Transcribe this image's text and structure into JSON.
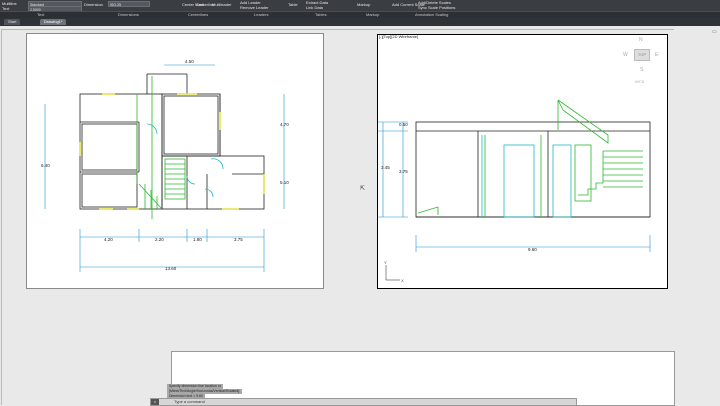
{
  "ribbon": {
    "left_top": "Multiline",
    "left_bottom": "Text",
    "dimension_label": "Dimension",
    "center_mark": "Center Mark",
    "centerline": "Centerline",
    "multileader": "Multileader",
    "add_leader": "Add Leader",
    "remove_leader": "Remove Leader",
    "table": "Table",
    "extract_data": "Extract Data",
    "link_data": "Link Data",
    "markup_import": "Markup",
    "add_current_scale": "Add Current Scale",
    "add_delete_scales": "Add/Delete Scales",
    "sync_scale": "Sync Scale Positions",
    "font_value": "Standard",
    "size_value": "2.5000",
    "dim_style": "ISO-25"
  },
  "panels": [
    "Text",
    "Dimensions",
    "Centerlines",
    "Leaders",
    "Tables",
    "Markup",
    "Annotation Scaling"
  ],
  "tabs": [
    {
      "label": "Start"
    },
    {
      "label": "Drawing1*"
    }
  ],
  "viewport": {
    "label": "[-][Top][2D Wireframe]"
  },
  "viewcube": {
    "n": "N",
    "w": "W",
    "top": "TOP",
    "e": "E",
    "s": "S",
    "wcs": "WCS"
  },
  "plan": {
    "dims": {
      "top_width": "4.50",
      "right_upper": "4.70",
      "right_lower": "5.10",
      "left_height": "6.40",
      "bottom_a": "4.20",
      "bottom_b": "2.20",
      "bottom_c": "1.80",
      "bottom_d": "3.75",
      "bottom_total": "13.60"
    }
  },
  "section": {
    "dims": {
      "upper": "0.50",
      "mid": "3.45",
      "left": "3.75",
      "width": "9.60"
    }
  },
  "command": {
    "history": [
      "Specify dimension line location or",
      "[Mtext/Text/Angle/Horizontal/Vertical/Rotated]:",
      "Dimension text = 9.60"
    ],
    "prompt": "Type a command"
  }
}
